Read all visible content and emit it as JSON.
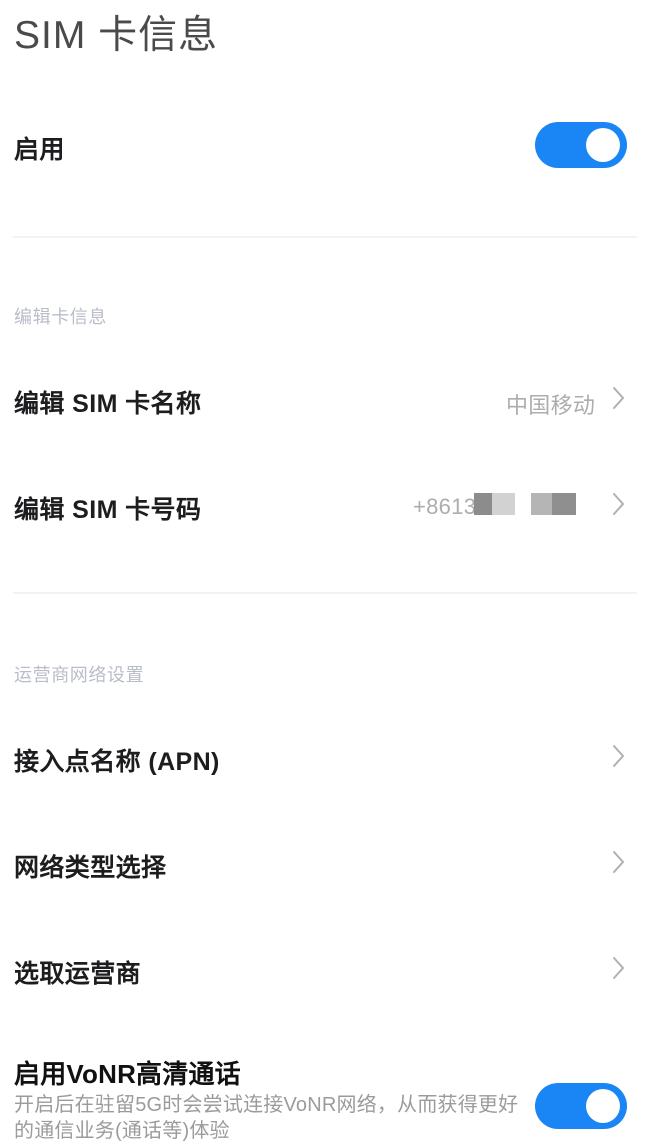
{
  "page": {
    "title": "SIM 卡信息"
  },
  "enable_row": {
    "label": "启用",
    "toggle_state": "on",
    "toggle_color": "#1a86f5"
  },
  "card_info_section": {
    "header": "编辑卡信息",
    "rows": [
      {
        "label": "编辑 SIM 卡名称",
        "value": "中国移动",
        "chevron": "chevron-right-icon"
      },
      {
        "label": "编辑 SIM 卡号码",
        "value": "+8613",
        "value_redacted": true,
        "chevron": "chevron-right-icon"
      }
    ]
  },
  "operator_section": {
    "header": "运营商网络设置",
    "rows": [
      {
        "label": "接入点名称 (APN)",
        "chevron": "chevron-right-icon"
      },
      {
        "label": "网络类型选择",
        "chevron": "chevron-right-icon"
      },
      {
        "label": "选取运营商",
        "chevron": "chevron-right-icon"
      }
    ]
  },
  "vonr_row": {
    "title": "启用VoNR高清通话",
    "description": "开启后在驻留5G时会尝试连接VoNR网络，从而获得更好的通信业务(通话等)体验",
    "toggle_state": "on",
    "toggle_color": "#1a86f5"
  },
  "colors": {
    "background": "#ffffff",
    "label_text": "#1d1d1f",
    "value_text": "#adadad",
    "section_header": "#b9bdc9",
    "divider": "#f1f2f4",
    "accent_blue": "#1a86f5",
    "redact_dark": "#8c8c8c",
    "redact_light": "#d2d2d2",
    "redact_mid": "#b5b5b5"
  }
}
